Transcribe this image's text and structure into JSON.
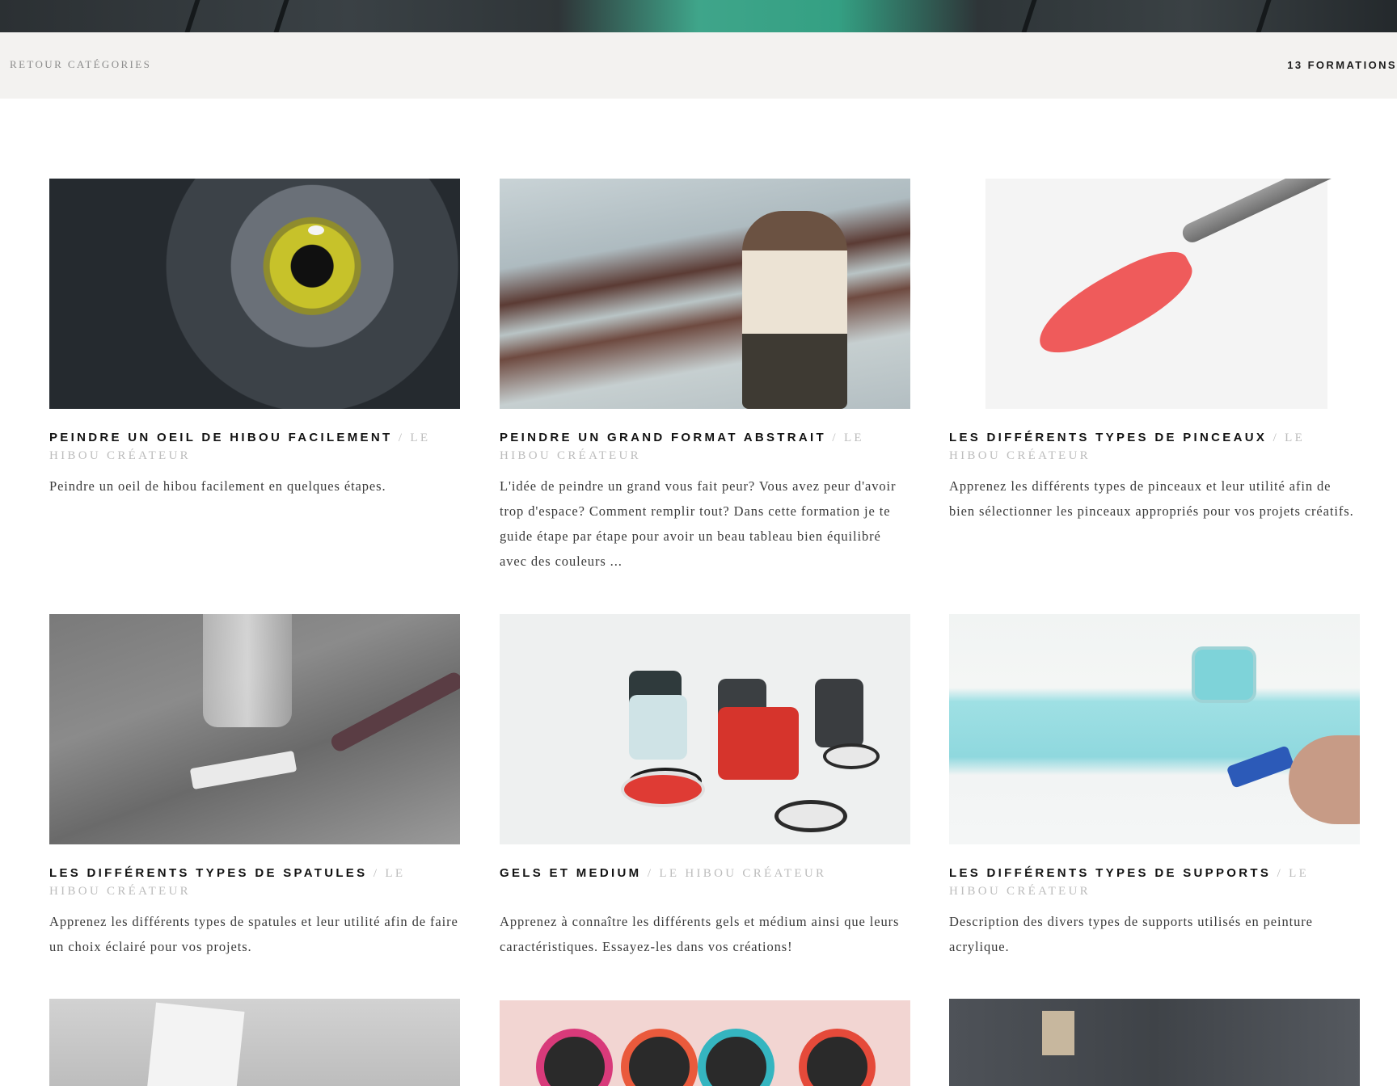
{
  "nav": {
    "back_label": "RETOUR CATÉGORIES",
    "count_label": "13 FORMATIONS"
  },
  "courses": [
    {
      "title": "PEINDRE UN OEIL DE HIBOU FACILEMENT",
      "author": "LE HIBOU CRÉATEUR",
      "description": " Peindre un oeil de hibou facilement en quelques étapes."
    },
    {
      "title": "PEINDRE UN GRAND FORMAT ABSTRAIT",
      "author": "LE HIBOU CRÉATEUR",
      "description": "L'idée de peindre un grand vous fait peur? Vous avez peur d'avoir trop d'espace? Comment remplir tout? Dans cette formation je te guide étape par étape pour avoir un beau tableau bien équilibré avec des couleurs ..."
    },
    {
      "title": "LES DIFFÉRENTS TYPES DE PINCEAUX",
      "author": "LE HIBOU CRÉATEUR",
      "description": "Apprenez les différents types de pinceaux et leur utilité afin de bien sélectionner les pinceaux appropriés pour vos projets créatifs."
    },
    {
      "title": "LES DIFFÉRENTS TYPES DE SPATULES",
      "author": "LE HIBOU CRÉATEUR",
      "description": "Apprenez les différents types de spatules et leur utilité afin de faire un choix éclairé pour vos projets."
    },
    {
      "title": "GELS ET MEDIUM",
      "author": "LE HIBOU CRÉATEUR",
      "description": "Apprenez à connaître les différents gels et médium ainsi que leurs caractéristiques. Essayez-les dans vos créations!"
    },
    {
      "title": "LES DIFFÉRENTS TYPES DE SUPPORTS",
      "author": "LE HIBOU CRÉATEUR",
      "description": "Description des divers types de supports utilisés en peinture acrylique."
    }
  ],
  "separator": "/"
}
